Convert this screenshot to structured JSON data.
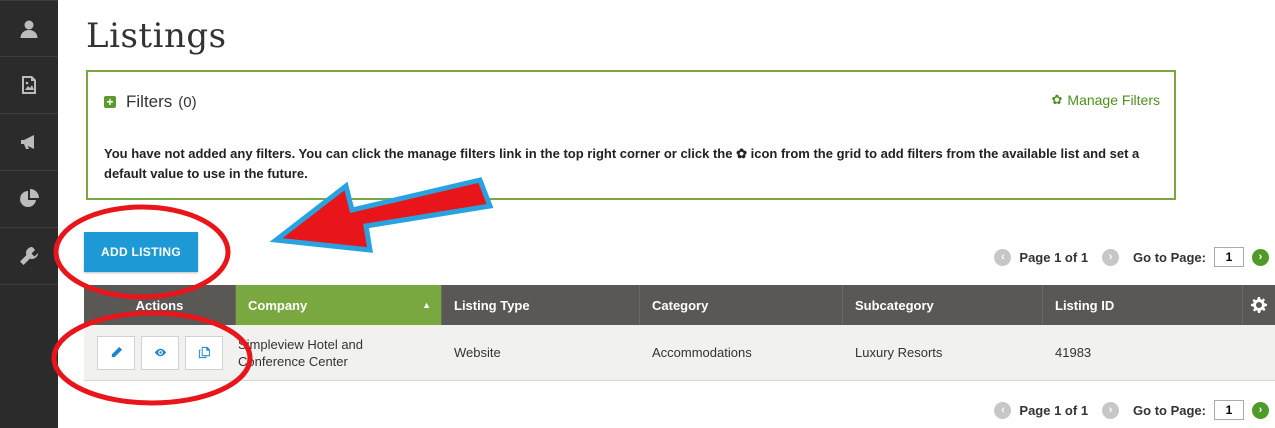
{
  "sidebar": {
    "items": [
      {
        "icon": "user-icon"
      },
      {
        "icon": "image-icon"
      },
      {
        "icon": "megaphone-icon"
      },
      {
        "icon": "pie-chart-icon"
      },
      {
        "icon": "wrench-icon"
      }
    ]
  },
  "page": {
    "title": "Listings"
  },
  "filters": {
    "title": "Filters",
    "count": "(0)",
    "manage_label": "Manage Filters",
    "message_part1": "You have not added any filters. You can click the manage filters link in the top right corner or click the",
    "message_part2": "icon from the grid to add filters from the available list and set a default value to use in the future."
  },
  "toolbar": {
    "add_listing_label": "ADD LISTING"
  },
  "pager": {
    "page_info": "Page 1 of 1",
    "goto_label": "Go to Page:",
    "goto_value": "1"
  },
  "grid": {
    "columns": [
      "Actions",
      "Company",
      "Listing Type",
      "Category",
      "Subcategory",
      "Listing ID"
    ],
    "rows": [
      {
        "company_line1": "Simpleview Hotel and",
        "company_line2": "Conference Center",
        "listing_type": "Website",
        "category": "Accommodations",
        "subcategory": "Luxury Resorts",
        "listing_id": "41983"
      }
    ]
  },
  "colors": {
    "accent_green": "#79a840",
    "button_blue": "#1d9ad6",
    "header_gray": "#5a5855",
    "sidebar_bg": "#2b2b2b",
    "annotation_red": "#e8151b",
    "annotation_blue": "#29a3e0"
  }
}
